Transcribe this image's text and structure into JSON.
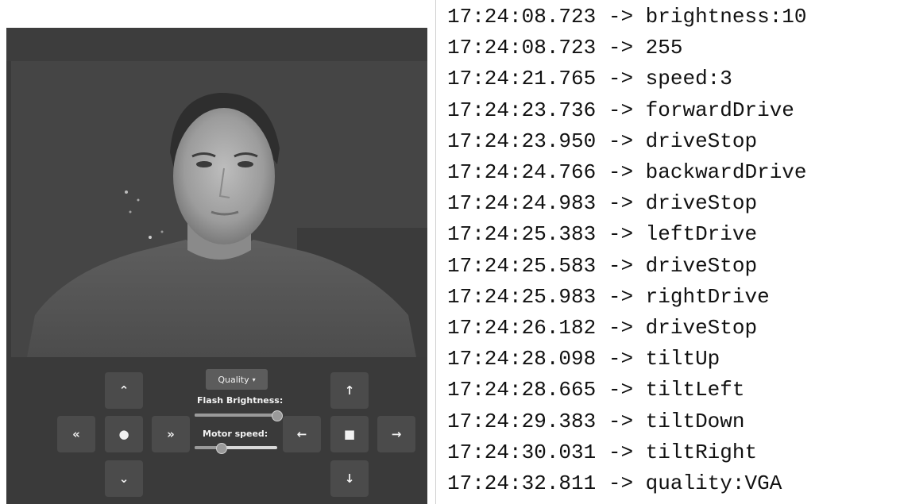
{
  "controls": {
    "quality_label": "Quality",
    "quality_caret": "▾",
    "flash_brightness_label": "Flash Brightness:",
    "motor_speed_label": "Motor speed:",
    "flash_brightness_level": 1.0,
    "motor_speed_level": 0.33,
    "buttons": {
      "tilt_up": "⌃",
      "tilt_down": "⌄",
      "tilt_left": "«",
      "tilt_right": "»",
      "tilt_center": "●",
      "drive_forward": "↑",
      "drive_backward": "↓",
      "drive_left": "←",
      "drive_right": "→",
      "drive_stop": "■"
    }
  },
  "log": [
    {
      "time": "17:24:08.723",
      "arrow": "->",
      "message": "brightness:10"
    },
    {
      "time": "17:24:08.723",
      "arrow": "->",
      "message": "255"
    },
    {
      "time": "17:24:21.765",
      "arrow": "->",
      "message": "speed:3"
    },
    {
      "time": "17:24:23.736",
      "arrow": "->",
      "message": "forwardDrive"
    },
    {
      "time": "17:24:23.950",
      "arrow": "->",
      "message": "driveStop"
    },
    {
      "time": "17:24:24.766",
      "arrow": "->",
      "message": "backwardDrive"
    },
    {
      "time": "17:24:24.983",
      "arrow": "->",
      "message": "driveStop"
    },
    {
      "time": "17:24:25.383",
      "arrow": "->",
      "message": "leftDrive"
    },
    {
      "time": "17:24:25.583",
      "arrow": "->",
      "message": "driveStop"
    },
    {
      "time": "17:24:25.983",
      "arrow": "->",
      "message": "rightDrive"
    },
    {
      "time": "17:24:26.182",
      "arrow": "->",
      "message": "driveStop"
    },
    {
      "time": "17:24:28.098",
      "arrow": "->",
      "message": "tiltUp"
    },
    {
      "time": "17:24:28.665",
      "arrow": "->",
      "message": "tiltLeft"
    },
    {
      "time": "17:24:29.383",
      "arrow": "->",
      "message": "tiltDown"
    },
    {
      "time": "17:24:30.031",
      "arrow": "->",
      "message": "tiltRight"
    },
    {
      "time": "17:24:32.811",
      "arrow": "->",
      "message": "quality:VGA"
    }
  ]
}
